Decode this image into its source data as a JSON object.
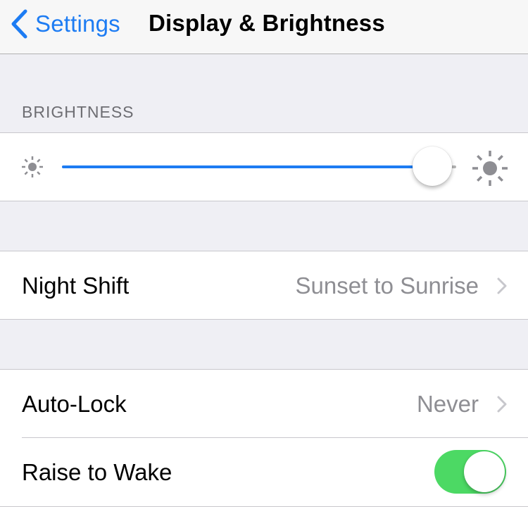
{
  "navbar": {
    "back_label": "Settings",
    "title": "Display & Brightness"
  },
  "brightness": {
    "section_header": "BRIGHTNESS",
    "level_percent": 94,
    "low_icon": "sun-small-icon",
    "high_icon": "sun-large-icon"
  },
  "night_shift": {
    "label": "Night Shift",
    "value": "Sunset to Sunrise"
  },
  "auto_lock": {
    "label": "Auto-Lock",
    "value": "Never"
  },
  "raise_to_wake": {
    "label": "Raise to Wake",
    "enabled": true
  },
  "colors": {
    "tint": "#1d7cf3",
    "switch_on": "#4cd964",
    "background": "#efeff4",
    "secondary_text": "#8e8e93"
  }
}
